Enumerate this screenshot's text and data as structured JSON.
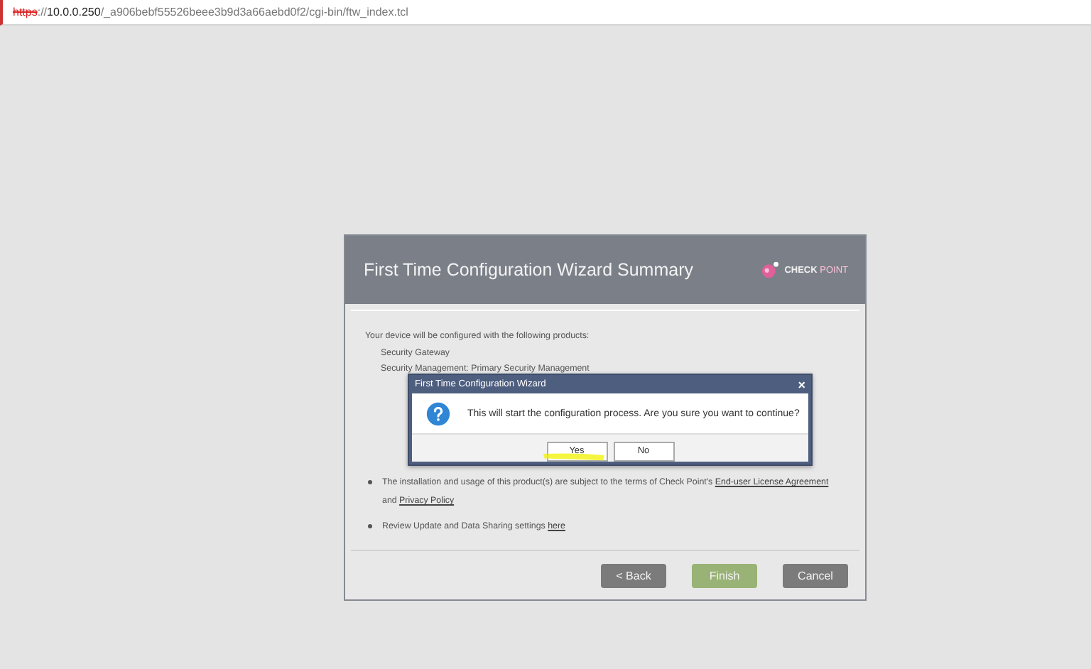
{
  "address_bar": {
    "scheme": "https",
    "rest_prefix": "://",
    "host": "10.0.0.250",
    "path": "/_a906bebf55526beee3b9d3a66aebd0f2/cgi-bin/ftw_index.tcl"
  },
  "wizard": {
    "title": "First Time Configuration Wizard Summary",
    "logo": {
      "bold": "CHECK",
      "light": "POINT"
    },
    "intro": "Your device will be configured with the following products:",
    "products": [
      "Security Gateway",
      "Security Management: Primary Security Management"
    ],
    "notes": [
      {
        "parts": [
          {
            "kind": "text",
            "text": "The installation and usage of this product(s) are subject to the terms of Check Point's "
          },
          {
            "kind": "link",
            "text": "End-user License Agreement"
          },
          {
            "kind": "text",
            "text": " and "
          },
          {
            "kind": "link",
            "text": "Privacy Policy"
          }
        ]
      },
      {
        "parts": [
          {
            "kind": "text",
            "text": "Review Update and Data Sharing settings "
          },
          {
            "kind": "link",
            "text": "here"
          }
        ]
      }
    ],
    "buttons": [
      {
        "label": "< Back",
        "kind": "back"
      },
      {
        "label": "Finish",
        "kind": "finish"
      },
      {
        "label": "Cancel",
        "kind": "cancel"
      }
    ]
  },
  "dialog": {
    "title": "First Time Configuration Wizard",
    "close": "×",
    "message": "This will start the configuration process. Are you sure you want to continue?",
    "buttons": [
      {
        "label": "Yes",
        "highlighted": true
      },
      {
        "label": "No",
        "highlighted": false
      }
    ]
  }
}
